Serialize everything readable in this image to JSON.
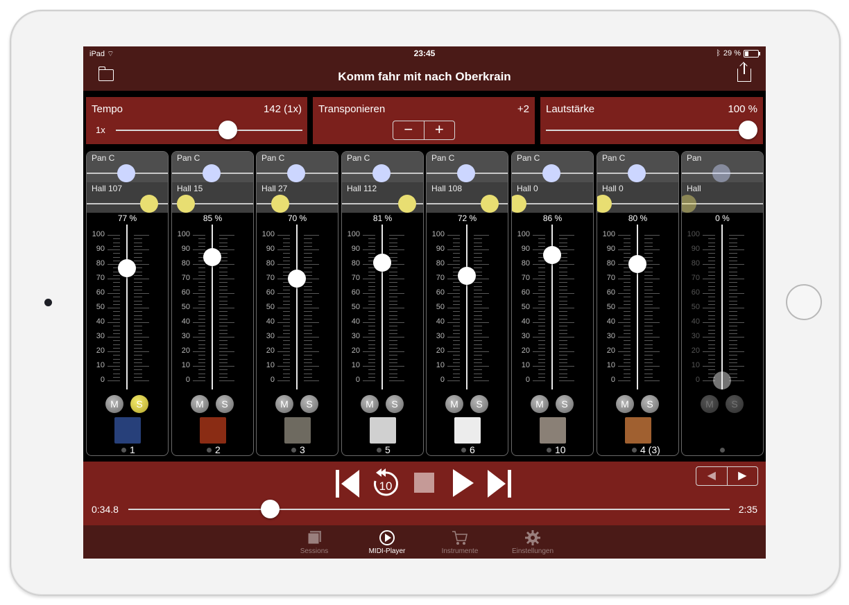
{
  "status": {
    "device": "iPad",
    "time": "23:45",
    "battery": "29 %"
  },
  "nav": {
    "title": "Komm fahr mit nach Oberkrain"
  },
  "tempo": {
    "label": "Tempo",
    "value": "142 (1x)",
    "multiplier": "1x",
    "level": 0.6
  },
  "transpose": {
    "label": "Transponieren",
    "value": "+2",
    "minus": "−",
    "plus": "+"
  },
  "volume": {
    "label": "Lautstärke",
    "value": "100 %",
    "level": 1.0
  },
  "ticks": [
    "100",
    "90",
    "80",
    "70",
    "60",
    "50",
    "40",
    "30",
    "20",
    "10",
    "0"
  ],
  "channels": [
    {
      "pan": "Pan C",
      "hall": "Hall 107",
      "pct": "77 %",
      "level": 0.77,
      "panPos": 0.5,
      "hallPos": 0.84,
      "m": "M",
      "s": "S",
      "solo": true,
      "chan": "1",
      "instrument": "accordion-icon",
      "color": "#27407a"
    },
    {
      "pan": "Pan C",
      "hall": "Hall 15",
      "pct": "85 %",
      "level": 0.85,
      "panPos": 0.5,
      "hallPos": 0.12,
      "m": "M",
      "s": "S",
      "solo": false,
      "chan": "2",
      "instrument": "guitar-icon",
      "color": "#8a2c14"
    },
    {
      "pan": "Pan C",
      "hall": "Hall 27",
      "pct": "70 %",
      "level": 0.7,
      "panPos": 0.5,
      "hallPos": 0.27,
      "m": "M",
      "s": "S",
      "solo": false,
      "chan": "3",
      "instrument": "saxophone-icon",
      "color": "#6e6a60"
    },
    {
      "pan": "Pan C",
      "hall": "Hall 112",
      "pct": "81 %",
      "level": 0.81,
      "panPos": 0.5,
      "hallPos": 0.88,
      "m": "M",
      "s": "S",
      "solo": false,
      "chan": "5",
      "instrument": "trumpet-icon",
      "color": "#d0d0d0"
    },
    {
      "pan": "Pan C",
      "hall": "Hall 108",
      "pct": "72 %",
      "level": 0.72,
      "panPos": 0.5,
      "hallPos": 0.85,
      "m": "M",
      "s": "S",
      "solo": false,
      "chan": "6",
      "instrument": "clarinet-icon",
      "color": "#ececec"
    },
    {
      "pan": "Pan C",
      "hall": "Hall 0",
      "pct": "86 %",
      "level": 0.86,
      "panPos": 0.5,
      "hallPos": 0.0,
      "m": "M",
      "s": "S",
      "solo": false,
      "chan": "10",
      "instrument": "drum-icon",
      "color": "#8a8076"
    },
    {
      "pan": "Pan C",
      "hall": "Hall 0",
      "pct": "80 %",
      "level": 0.8,
      "panPos": 0.5,
      "hallPos": 0.0,
      "m": "M",
      "s": "S",
      "solo": false,
      "chan": "4 (3)",
      "instrument": "bass-guitar-icon",
      "color": "#a06030"
    },
    {
      "pan": "Pan",
      "hall": "Hall",
      "pct": "0 %",
      "level": 0.0,
      "panPos": 0.5,
      "hallPos": 0.0,
      "m": "M",
      "s": "S",
      "solo": false,
      "chan": "",
      "instrument": "",
      "color": ""
    }
  ],
  "transport": {
    "position": "0:34.8",
    "duration": "2:35",
    "progress": 0.235,
    "skip_label": "10"
  },
  "tabs": [
    {
      "label": "Sessions",
      "icon": "sessions-icon"
    },
    {
      "label": "MIDI-Player",
      "icon": "play-circle-icon"
    },
    {
      "label": "Instrumente",
      "icon": "cart-icon"
    },
    {
      "label": "Einstellungen",
      "icon": "gear-icon"
    }
  ],
  "colors": {
    "accent": "#7b201c",
    "bar": "#4a1a17",
    "solo": "#d8cc40",
    "panKnob": "#ccd6ff",
    "hallKnob": "#e8de72"
  }
}
